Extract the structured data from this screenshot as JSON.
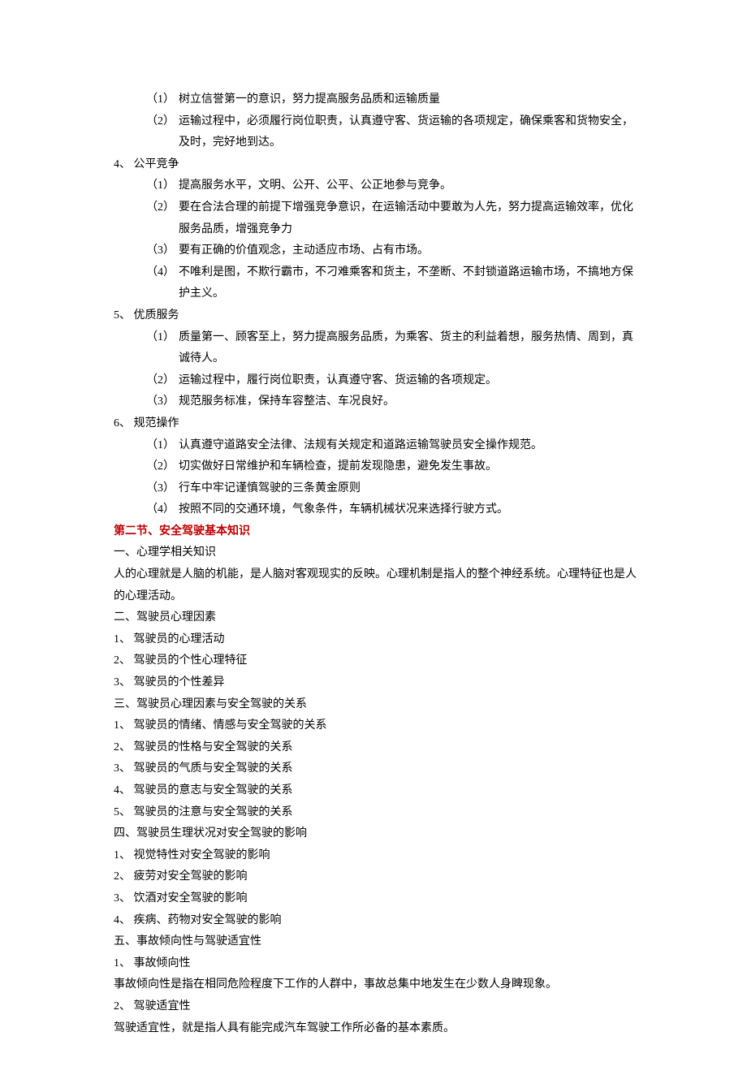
{
  "items": [
    {
      "type": "sub",
      "num": "（1）",
      "text": "树立信誉第一的意识，努力提高服务品质和运输质量"
    },
    {
      "type": "sub",
      "num": "（2）",
      "text": "运输过程中，必须履行岗位职责，认真遵守客、货运输的各项规定，确保乘客和货物安全，及时，完好地到达。"
    },
    {
      "type": "num",
      "text": "4、 公平竞争"
    },
    {
      "type": "sub",
      "num": "（1）",
      "text": "提高服务水平，文明、公开、公平、公正地参与竞争。"
    },
    {
      "type": "sub",
      "num": "（2）",
      "text": "要在合法合理的前提下增强竞争意识，在运输活动中要敢为人先，努力提高运输效率，优化服务品质，增强竞争力"
    },
    {
      "type": "sub",
      "num": "（3）",
      "text": "要有正确的价值观念，主动适应市场、占有市场。"
    },
    {
      "type": "sub",
      "num": "（4）",
      "text": "不唯利是图，不欺行霸市，不刁难乘客和货主，不垄断、不封锁道路运输市场，不搞地方保护主义。"
    },
    {
      "type": "num",
      "text": "5、 优质服务"
    },
    {
      "type": "sub",
      "num": "（1）",
      "text": "质量第一、顾客至上，努力提高服务品质，为乘客、货主的利益着想，服务热情、周到，真诚待人。"
    },
    {
      "type": "sub",
      "num": "（2）",
      "text": "运输过程中，履行岗位职责，认真遵守客、货运输的各项规定。"
    },
    {
      "type": "sub",
      "num": "（3）",
      "text": "规范服务标准，保持车容整洁、车况良好。"
    },
    {
      "type": "num",
      "text": "6、 规范操作"
    },
    {
      "type": "sub",
      "num": "（1）",
      "text": "认真遵守道路安全法律、法规有关规定和道路运输驾驶员安全操作规范。"
    },
    {
      "type": "sub",
      "num": "（2）",
      "text": "切实做好日常维护和车辆检查，提前发现隐患，避免发生事故。"
    },
    {
      "type": "sub",
      "num": "（3）",
      "text": "行车中牢记谨慎驾驶的三条黄金原则"
    },
    {
      "type": "sub",
      "num": "（4）",
      "text": "按照不同的交通环境，气象条件，车辆机械状况来选择行驶方式。"
    },
    {
      "type": "heading",
      "text": "第二节、安全驾驶基本知识"
    },
    {
      "type": "para",
      "text": "一、心理学相关知识"
    },
    {
      "type": "para",
      "text": "人的心理就是人脑的机能，是人脑对客观现实的反映。心理机制是指人的整个神经系统。心理特征也是人的心理活动。"
    },
    {
      "type": "para",
      "text": "二、驾驶员心理因素"
    },
    {
      "type": "para",
      "text": "1、 驾驶员的心理活动"
    },
    {
      "type": "para",
      "text": "2、 驾驶员的个性心理特征"
    },
    {
      "type": "para",
      "text": "3、 驾驶员的个性差异"
    },
    {
      "type": "para",
      "text": "三、驾驶员心理因素与安全驾驶的关系"
    },
    {
      "type": "para",
      "text": "1、 驾驶员的情绪、情感与安全驾驶的关系"
    },
    {
      "type": "para",
      "text": "2、 驾驶员的性格与安全驾驶的关系"
    },
    {
      "type": "para",
      "text": "3、 驾驶员的气质与安全驾驶的关系"
    },
    {
      "type": "para",
      "text": "4、 驾驶员的意志与安全驾驶的关系"
    },
    {
      "type": "para",
      "text": "5、 驾驶员的注意与安全驾驶的关系"
    },
    {
      "type": "para",
      "text": "四、驾驶员生理状况对安全驾驶的影响"
    },
    {
      "type": "para",
      "text": "1、 视觉特性对安全驾驶的影响"
    },
    {
      "type": "para",
      "text": "2、 疲劳对安全驾驶的影响"
    },
    {
      "type": "para",
      "text": "3、 饮酒对安全驾驶的影响"
    },
    {
      "type": "para",
      "text": "4、 疾病、药物对安全驾驶的影响"
    },
    {
      "type": "para",
      "text": "五、事故倾向性与驾驶适宜性"
    },
    {
      "type": "para",
      "text": "1、 事故倾向性"
    },
    {
      "type": "para",
      "text": "事故倾向性是指在相同危险程度下工作的人群中，事故总集中地发生在少数人身睥现象。"
    },
    {
      "type": "para",
      "text": "2、 驾驶适宜性"
    },
    {
      "type": "para",
      "text": "驾驶适宜性，就是指人具有能完成汽车驾驶工作所必备的基本素质。"
    }
  ]
}
